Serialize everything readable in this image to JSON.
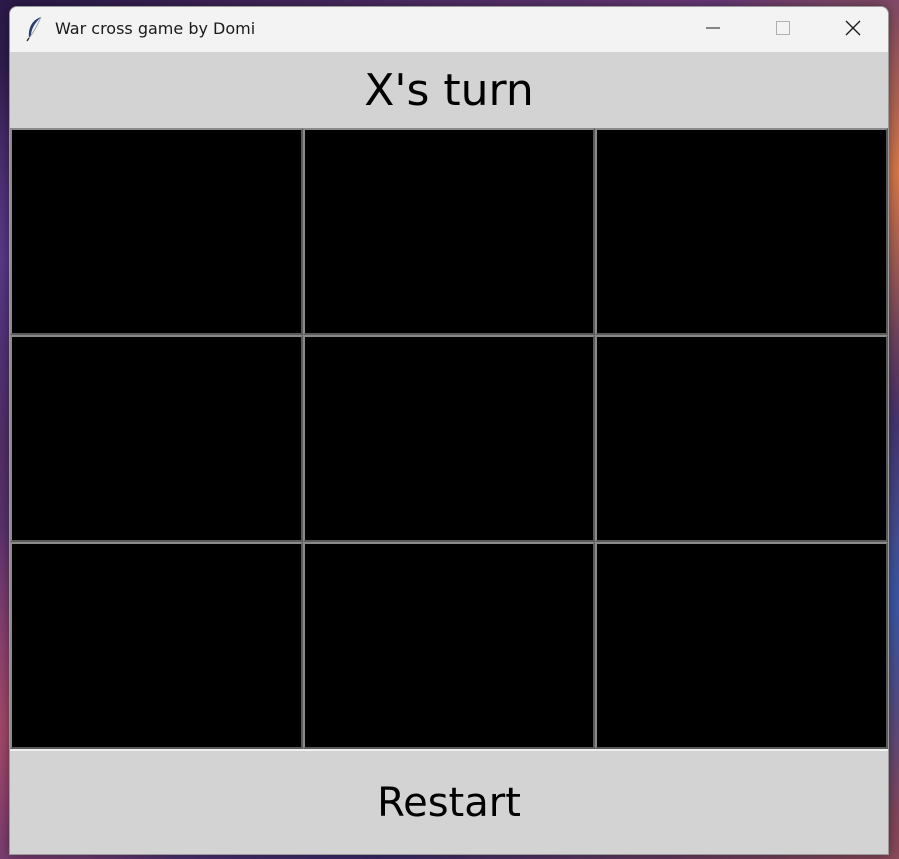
{
  "window": {
    "title": "War cross game by Domi",
    "icon": "feather-icon"
  },
  "controls": {
    "minimize_icon": "minimize-icon",
    "maximize_icon": "maximize-icon",
    "close_icon": "close-icon"
  },
  "game": {
    "turn_text": "X's turn",
    "cells": [
      "",
      "",
      "",
      "",
      "",
      "",
      "",
      "",
      ""
    ],
    "cell_color": "#000000",
    "background_color": "#d3d3d3"
  },
  "restart": {
    "label": "Restart"
  }
}
